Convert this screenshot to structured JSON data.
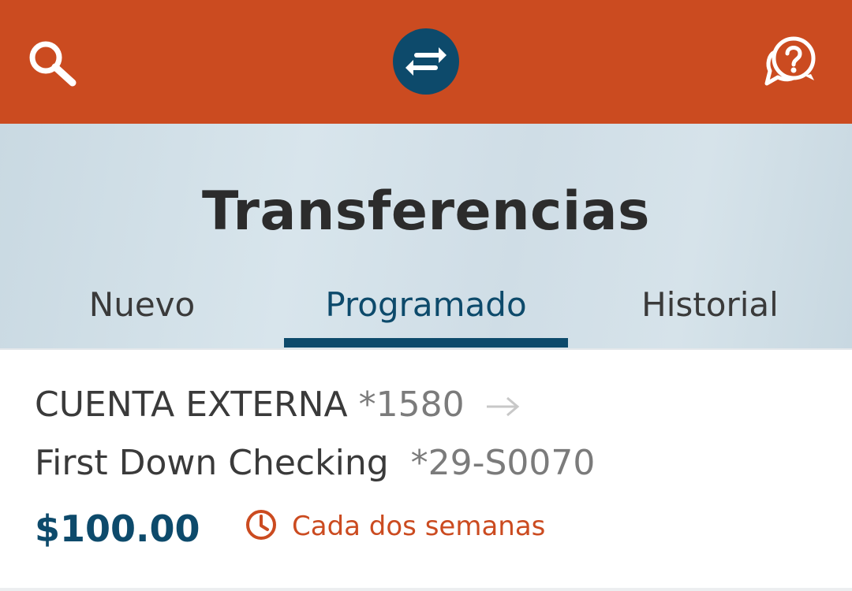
{
  "header": {
    "search_icon": "search-icon",
    "center_icon": "transfer-arrows-icon",
    "help_icon": "help-chat-icon",
    "accent_color": "#cb4b20",
    "brand_color": "#0d4a6b"
  },
  "hero": {
    "title": "Transferencias",
    "tabs": [
      {
        "label": "Nuevo",
        "active": false
      },
      {
        "label": "Programado",
        "active": true
      },
      {
        "label": "Historial",
        "active": false
      }
    ]
  },
  "transfer": {
    "from_name": "CUENTA EXTERNA",
    "from_number": "*1580",
    "to_name": "First Down Checking",
    "to_number": "*29-S0070",
    "amount": "$100.00",
    "frequency": "Cada dos semanas",
    "arrow_icon": "arrow-right-icon",
    "frequency_icon": "clock-icon"
  }
}
